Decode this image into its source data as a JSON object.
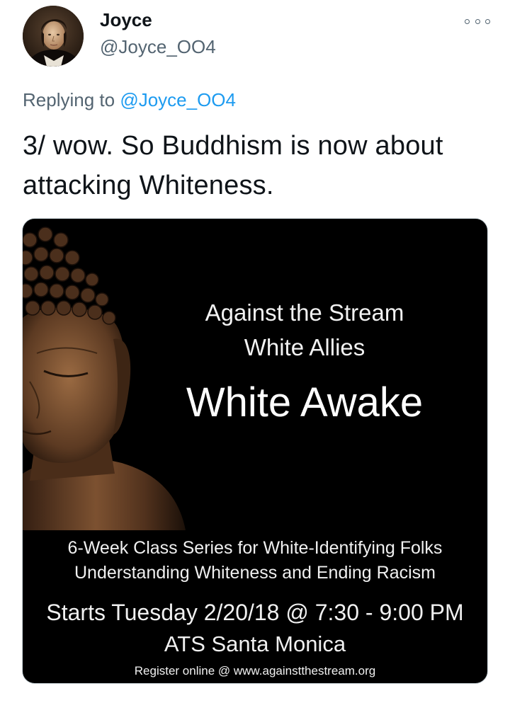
{
  "author": {
    "display_name": "Joyce",
    "handle": "@Joyce_OO4",
    "avatar_icon": "portrait-avatar"
  },
  "more_icon": "more-options-icon",
  "reply": {
    "prefix": "Replying to",
    "target": "@Joyce_OO4"
  },
  "tweet": {
    "text": "3/ wow. So Buddhism is now about attacking Whiteness."
  },
  "media": {
    "title_line1": "Against the Stream",
    "title_line2": "White Allies",
    "title_main": "White Awake",
    "desc_line1": "6-Week Class Series for White-Identifying Folks",
    "desc_line2": "Understanding Whiteness and Ending Racism",
    "schedule": "Starts Tuesday 2/20/18 @ 7:30 - 9:00 PM",
    "location": "ATS Santa Monica",
    "register": "Register online @ www.againstthestream.org"
  },
  "colors": {
    "link": "#1d9bf0",
    "secondary_text": "#536471",
    "primary_text": "#0f1419"
  }
}
